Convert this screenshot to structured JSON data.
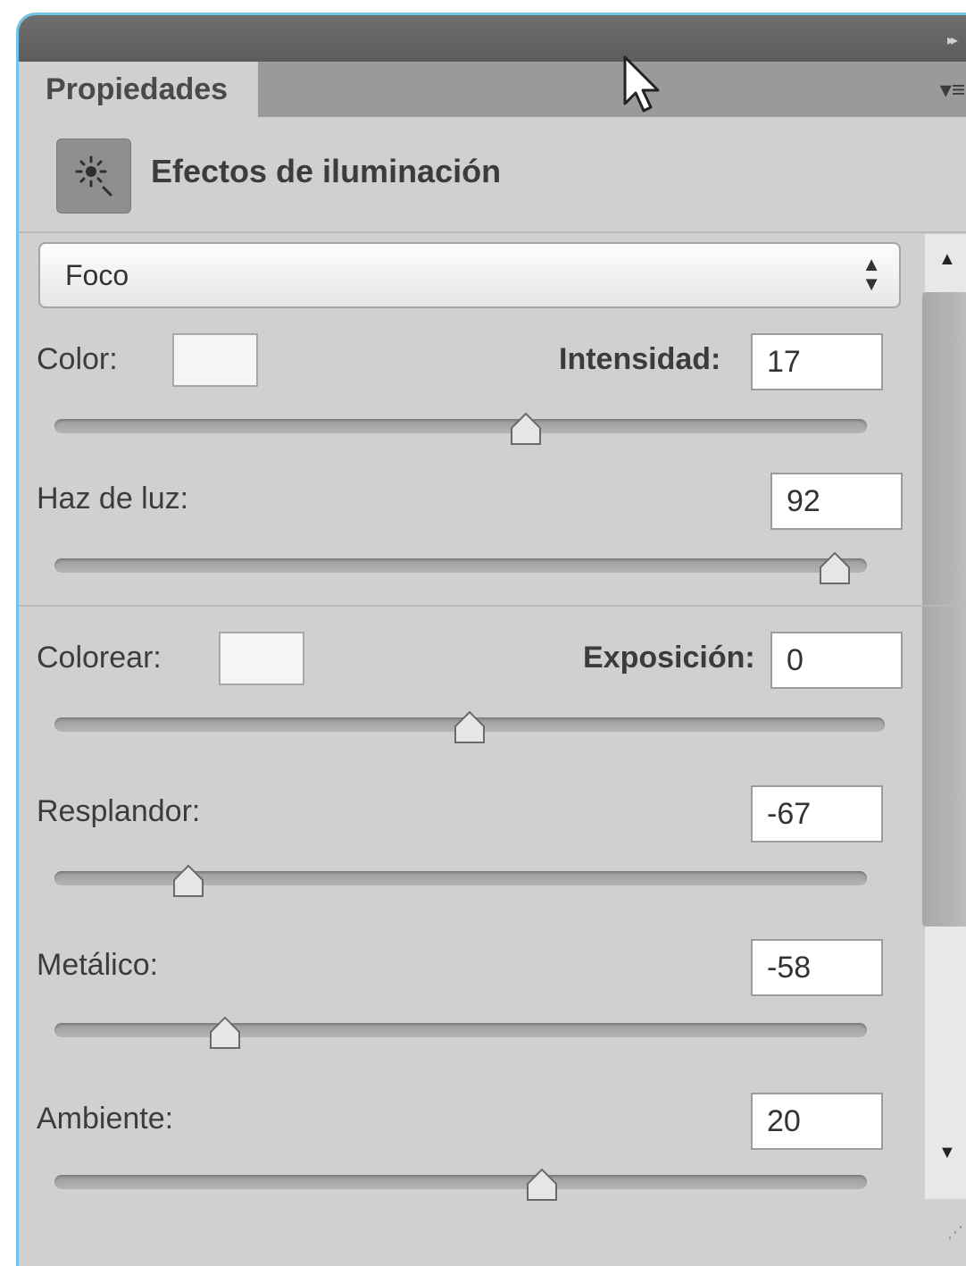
{
  "panel": {
    "tab_label": "Propiedades",
    "collapse_icon": "double-chevron-right-icon",
    "menu_icon": "panel-menu-icon"
  },
  "header": {
    "title": "Efectos de iluminación",
    "icon": "lighting-effects-icon"
  },
  "light_type": {
    "selected": "Foco"
  },
  "light": {
    "color_label": "Color:",
    "intensity_label": "Intensidad:",
    "intensity_value": "17",
    "intensity_level": 0.58,
    "hotspot_label": "Haz de luz:",
    "hotspot_value": "92",
    "hotspot_level": 0.96
  },
  "properties": {
    "colorize_label": "Colorear:",
    "exposure_label": "Exposición:",
    "exposure_value": "0",
    "exposure_level": 0.5,
    "gloss_label": "Resplandor:",
    "gloss_value": "-67",
    "gloss_level": 0.165,
    "metallic_label": "Metálico:",
    "metallic_value": "-58",
    "metallic_level": 0.21,
    "ambience_label": "Ambiente:",
    "ambience_value": "20",
    "ambience_level": 0.6
  },
  "colors": {
    "panel_bg": "#d0d0d0",
    "accent_border": "#6fc3e4",
    "header_bar": "#5c5c5c"
  }
}
